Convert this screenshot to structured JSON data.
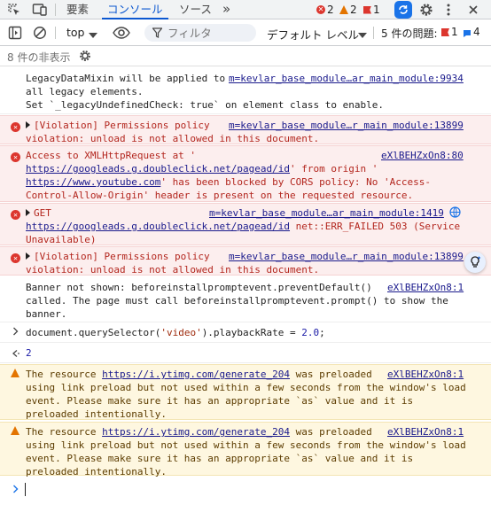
{
  "tabs": {
    "elements": "要素",
    "console": "コンソール",
    "sources": "ソース",
    "more": "»"
  },
  "counts": {
    "errors": "2",
    "warnings": "2",
    "issues": "1"
  },
  "toolbar": {
    "context": "top",
    "filter_placeholder": "フィルタ",
    "levels": "デフォルト レベル",
    "issues_label": "5 件の問題:",
    "issues_errors": "1",
    "issues_info": "4"
  },
  "hidden_label": "8 件の非表示",
  "messages": {
    "m1": {
      "l1": "LegacyDataMixin will be applied to ",
      "l2": "all legacy elements.",
      "l3": "Set `_legacyUndefinedCheck: true` on element class to enable.",
      "src": "m=kevlar_base_module…ar_main_module:9934"
    },
    "m2": {
      "l1": "[Violation] Permissions policy",
      "l2": "violation: unload is not allowed in this document.",
      "src": "m=kevlar_base_module…r_main_module:13899"
    },
    "m3": {
      "l1": "Access to XMLHttpRequest at '",
      "url1": "https://googleads.g.doubleclick.net/pagead/id",
      "l2b": "' from origin '",
      "url2": "https://www.youtube.com",
      "l3b": "' has been blocked by CORS policy: No 'Access-",
      "l4": "Control-Allow-Origin' header is present on the requested resource.",
      "src": "eXlBEHZxOn8:80"
    },
    "m4": {
      "l1": "GET",
      "url": "https://googleads.g.doubleclick.net/pagead/id",
      "l2b": " net::ERR_FAILED 503 (Service",
      "l3": "Unavailable)",
      "src": "m=kevlar_base_module…ar_main_module:1419"
    },
    "m5": {
      "l1": "[Violation] Permissions policy",
      "l2": "violation: unload is not allowed in this document.",
      "src": "m=kevlar_base_module…r_main_module:13899"
    },
    "m6": {
      "l1": "Banner not shown: beforeinstallpromptevent.preventDefault()",
      "l2": "called. The page must call beforeinstallpromptevent.prompt() to show the",
      "l3": "banner.",
      "src": "eXlBEHZxOn8:1"
    },
    "m7": {
      "a": "document.querySelector(",
      "s": "'video'",
      "b": ").playbackRate = ",
      "n": "2.0",
      "c": ";"
    },
    "m8": {
      "result": "2"
    },
    "m9": {
      "l1a": "The resource ",
      "url": "https://i.ytimg.com/generate_204",
      "l1b": " was preloaded",
      "l2": "using link preload but not used within a few seconds from the window's load",
      "l3": "event. Please make sure it has an appropriate `as` value and it is",
      "l4": "preloaded intentionally.",
      "src": "eXlBEHZxOn8:1"
    },
    "m10": {
      "l1a": "The resource ",
      "url": "https://i.ytimg.com/generate_204",
      "l1b": " was preloaded",
      "l2": "using link preload but not used within a few seconds from the window's load",
      "l3": "event. Please make sure it has an appropriate `as` value and it is",
      "l4": "preloaded intentionally.",
      "src": "eXlBEHZxOn8:1"
    }
  },
  "colors": {
    "accent": "#0b57d0",
    "error_bg": "#fceeee",
    "warning_bg": "#fef7e0",
    "error": "#dc362e",
    "warning": "#e37400"
  },
  "icons": [
    "inspect-icon",
    "device-icon",
    "error-icon",
    "warning-icon",
    "issue-flag-icon",
    "sync-icon",
    "gear-icon",
    "kebab-icon",
    "close-icon",
    "sidebar-icon",
    "clear-icon",
    "eye-icon",
    "filter-icon",
    "info-icon",
    "prompt-icon",
    "result-icon",
    "ai-lightbulb-icon"
  ]
}
